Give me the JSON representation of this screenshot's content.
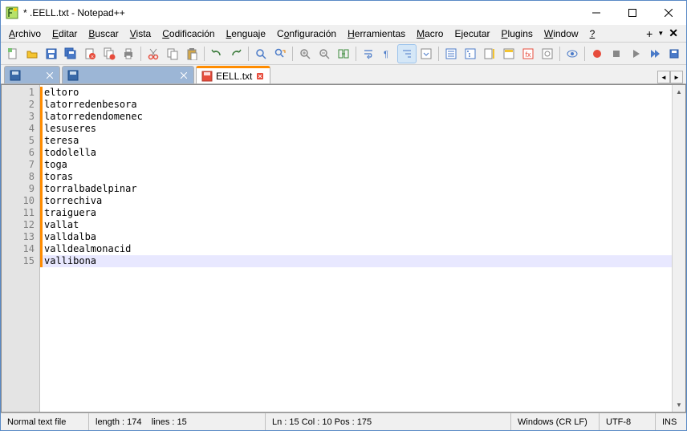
{
  "title": "*            .EELL.txt - Notepad++",
  "menus": [
    "Archivo",
    "Editar",
    "Buscar",
    "Vista",
    "Codificación",
    "Lenguaje",
    "Configuración",
    "Herramientas",
    "Macro",
    "Ejecutar",
    "Plugins",
    "Window",
    "?"
  ],
  "tabs": [
    {
      "label": "",
      "modified": false,
      "active": false
    },
    {
      "label": "",
      "modified": false,
      "active": false
    },
    {
      "label": "EELL.txt",
      "modified": true,
      "active": true
    }
  ],
  "lines": [
    "eltoro",
    "latorredenbesora",
    "latorredendomenec",
    "lesuseres",
    "teresa",
    "todolella",
    "toga",
    "toras",
    "torralbadelpinar",
    "torrechiva",
    "traiguera",
    "vallat",
    "valldalba",
    "valldealmonacid",
    "vallibona"
  ],
  "caret_line": 15,
  "status": {
    "doctype": "Normal text file",
    "length_label": "length : 174",
    "lines_label": "lines : 15",
    "pos_label": "Ln : 15    Col : 10    Pos : 175",
    "eol": "Windows (CR LF)",
    "encoding": "UTF-8",
    "ins": "INS"
  }
}
